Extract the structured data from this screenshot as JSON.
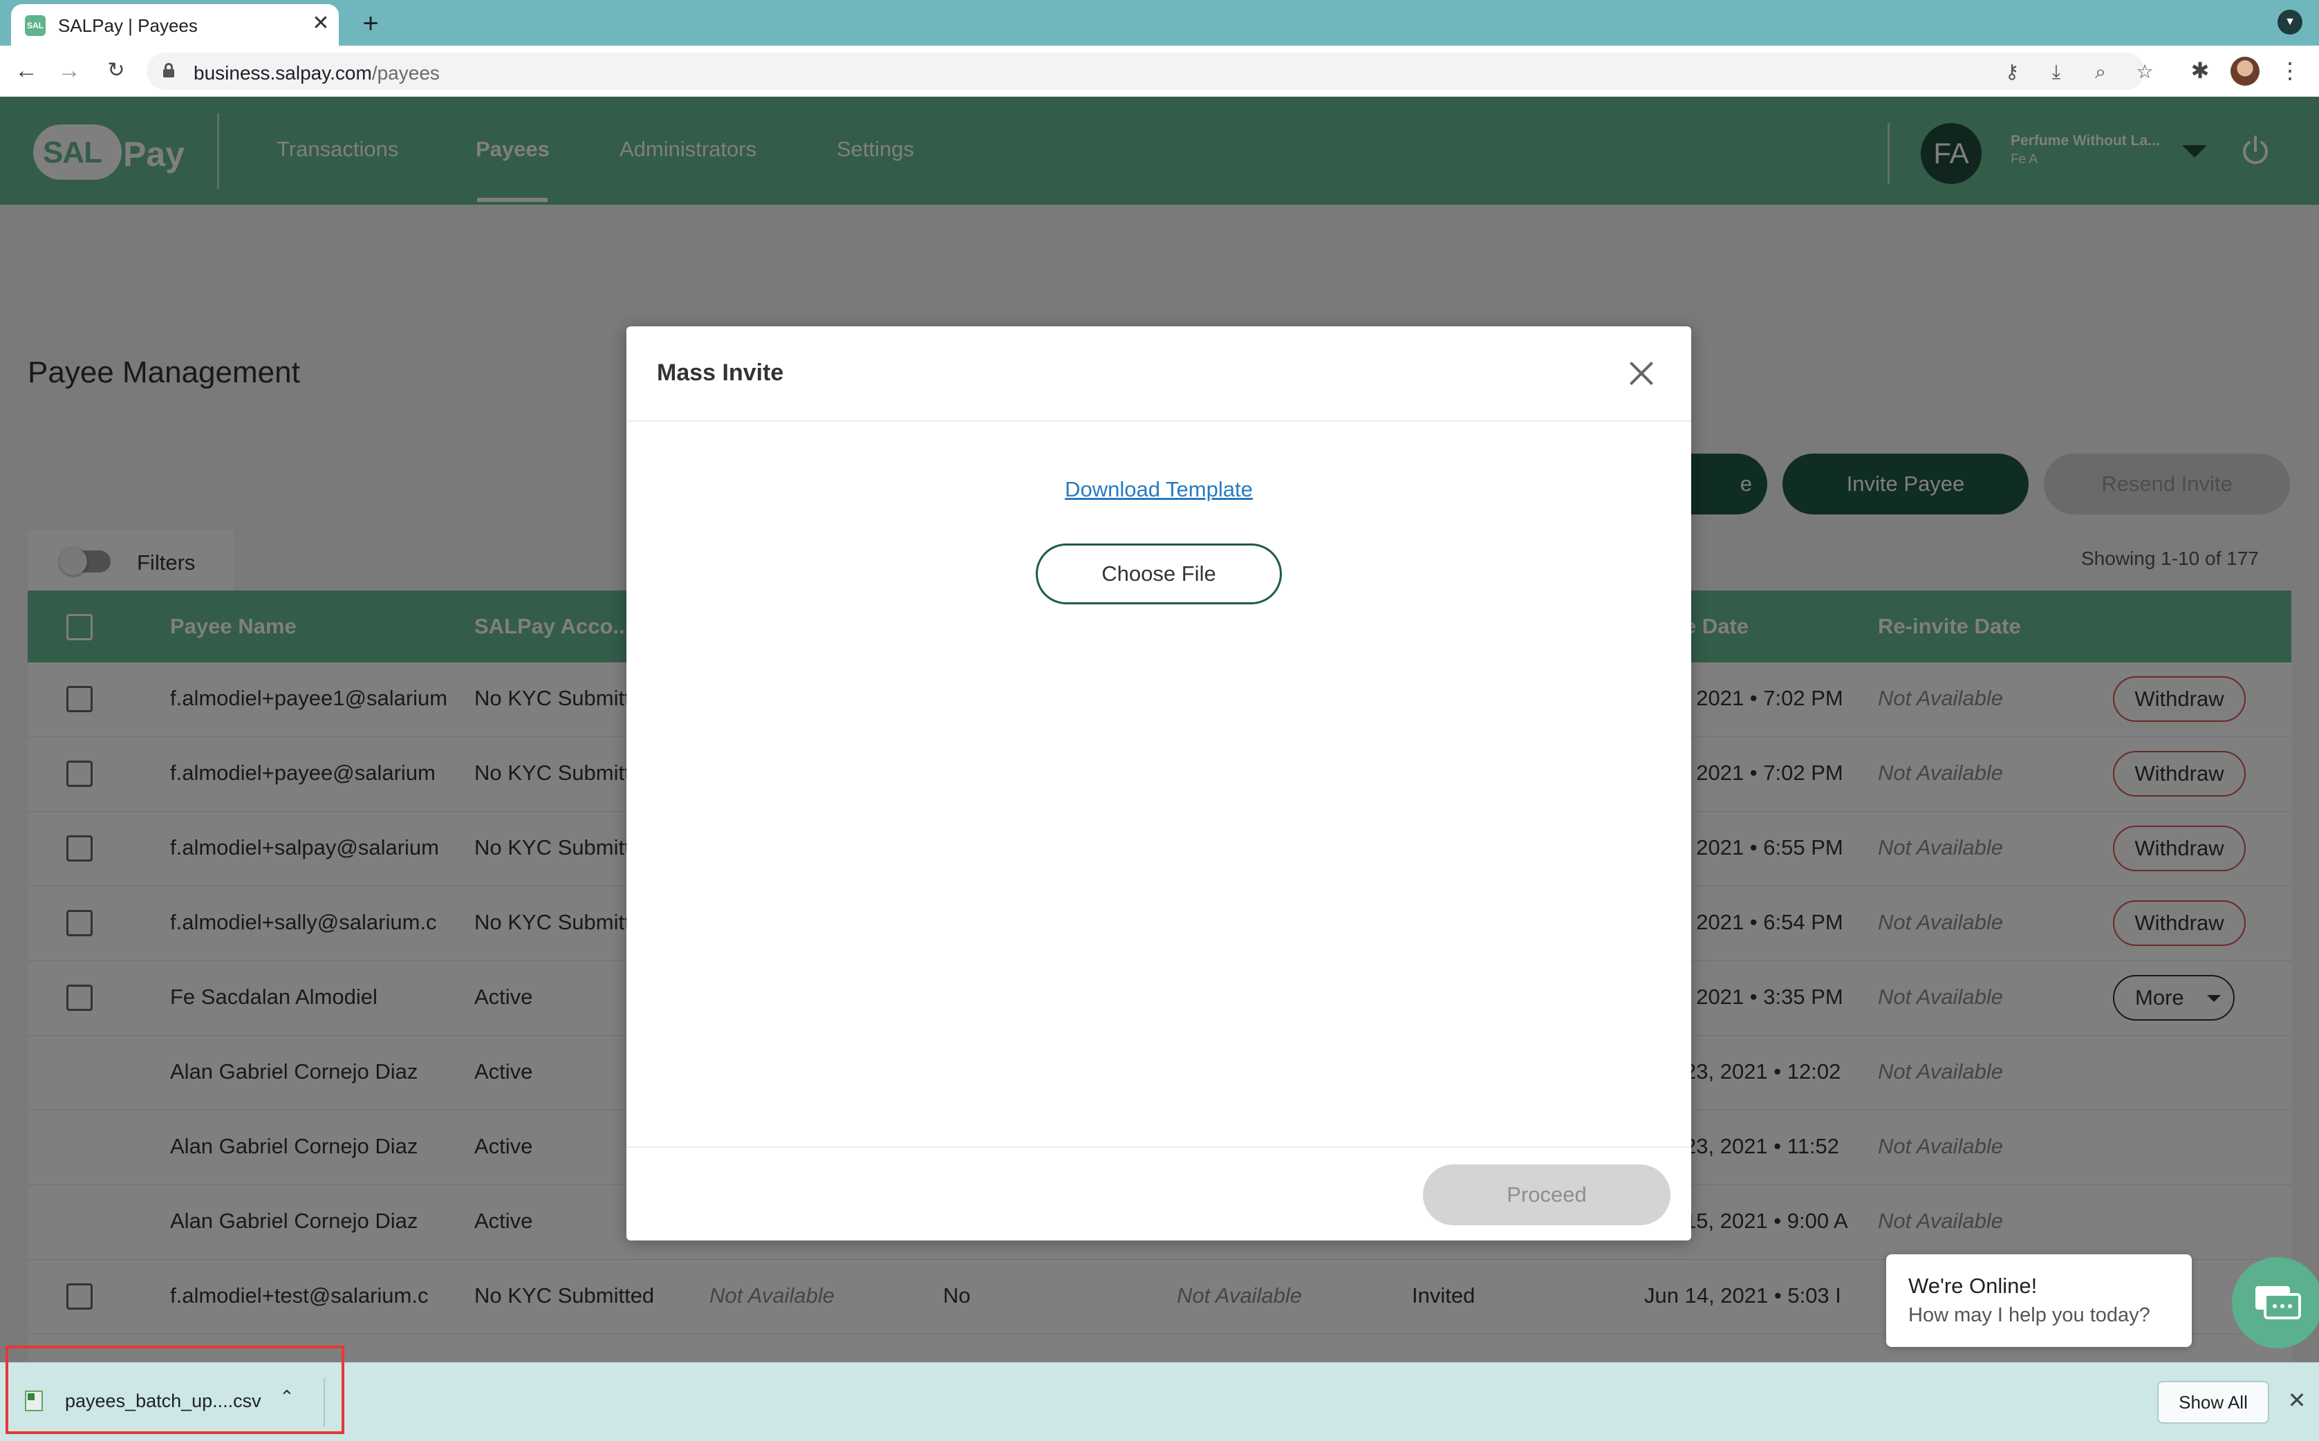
{
  "browser": {
    "tab_title": "SALPay | Payees",
    "favicon_text": "SAL",
    "tab_close": "✕",
    "new_tab": "+",
    "url_host": "business.salpay.com",
    "url_path": "/payees"
  },
  "app": {
    "logo_sal": "SAL",
    "logo_pay": "Pay",
    "nav": [
      "Transactions",
      "Payees",
      "Administrators",
      "Settings"
    ],
    "active_nav": "Payees",
    "avatar_initials": "FA",
    "account_name": "Perfume Without La...",
    "account_sub": "Fe A",
    "brand_color": "#66b892",
    "dark_color": "#1f5b45"
  },
  "page": {
    "title": "Payee Management",
    "partial_button_fragment": "e",
    "invite_payee": "Invite Payee",
    "resend_invite": "Resend Invite",
    "filters_label": "Filters",
    "showing": "Showing 1-10 of 177"
  },
  "table": {
    "headers": [
      "Payee Name",
      "SALPay Acco...",
      "e Date",
      "Re-invite Date"
    ],
    "rows": [
      {
        "name": "f.almodiel+payee1@salarium",
        "status": "No KYC Submitted",
        "date": ", 2021 • 7:02 PM",
        "reinvite": "Not Available",
        "action": "Withdraw"
      },
      {
        "name": "f.almodiel+payee@salarium",
        "status": "No KYC Submitted",
        "date": ", 2021 • 7:02 PM",
        "reinvite": "Not Available",
        "action": "Withdraw"
      },
      {
        "name": "f.almodiel+salpay@salarium",
        "status": "No KYC Submitted",
        "date": ", 2021 • 6:55 PM",
        "reinvite": "Not Available",
        "action": "Withdraw"
      },
      {
        "name": "f.almodiel+sally@salarium.c",
        "status": "No KYC Submitted",
        "date": ", 2021 • 6:54 PM",
        "reinvite": "Not Available",
        "action": "Withdraw"
      },
      {
        "name": "Fe Sacdalan Almodiel",
        "status": "Active",
        "date": ", 2021 • 3:35 PM",
        "reinvite": "Not Available",
        "action": "More"
      },
      {
        "name": "Alan Gabriel Cornejo Diaz",
        "status": "Active",
        "date": "23, 2021 • 12:02",
        "reinvite": "Not Available",
        "action": ""
      },
      {
        "name": "Alan Gabriel Cornejo Diaz",
        "status": "Active",
        "date": "23, 2021 • 11:52",
        "reinvite": "Not Available",
        "action": ""
      },
      {
        "name": "Alan Gabriel Cornejo Diaz",
        "status": "Active",
        "date": "15, 2021 • 9:00 A",
        "reinvite": "Not Available",
        "action": ""
      }
    ],
    "last_row": {
      "name": "f.almodiel+test@salarium.c",
      "status": "No KYC Submitted",
      "col3": "Not Available",
      "col4": "No",
      "col5": "Not Available",
      "col6": "Invited",
      "date": "Jun 14, 2021 • 5:03 I"
    }
  },
  "modal": {
    "title": "Mass Invite",
    "download_template": "Download Template",
    "choose_file": "Choose File",
    "proceed": "Proceed"
  },
  "chat": {
    "title": "We're Online!",
    "subtitle": "How may I help you today?"
  },
  "download_bar": {
    "file_name": "payees_batch_up....csv",
    "show_all": "Show All",
    "highlight_color": "#e53935"
  }
}
